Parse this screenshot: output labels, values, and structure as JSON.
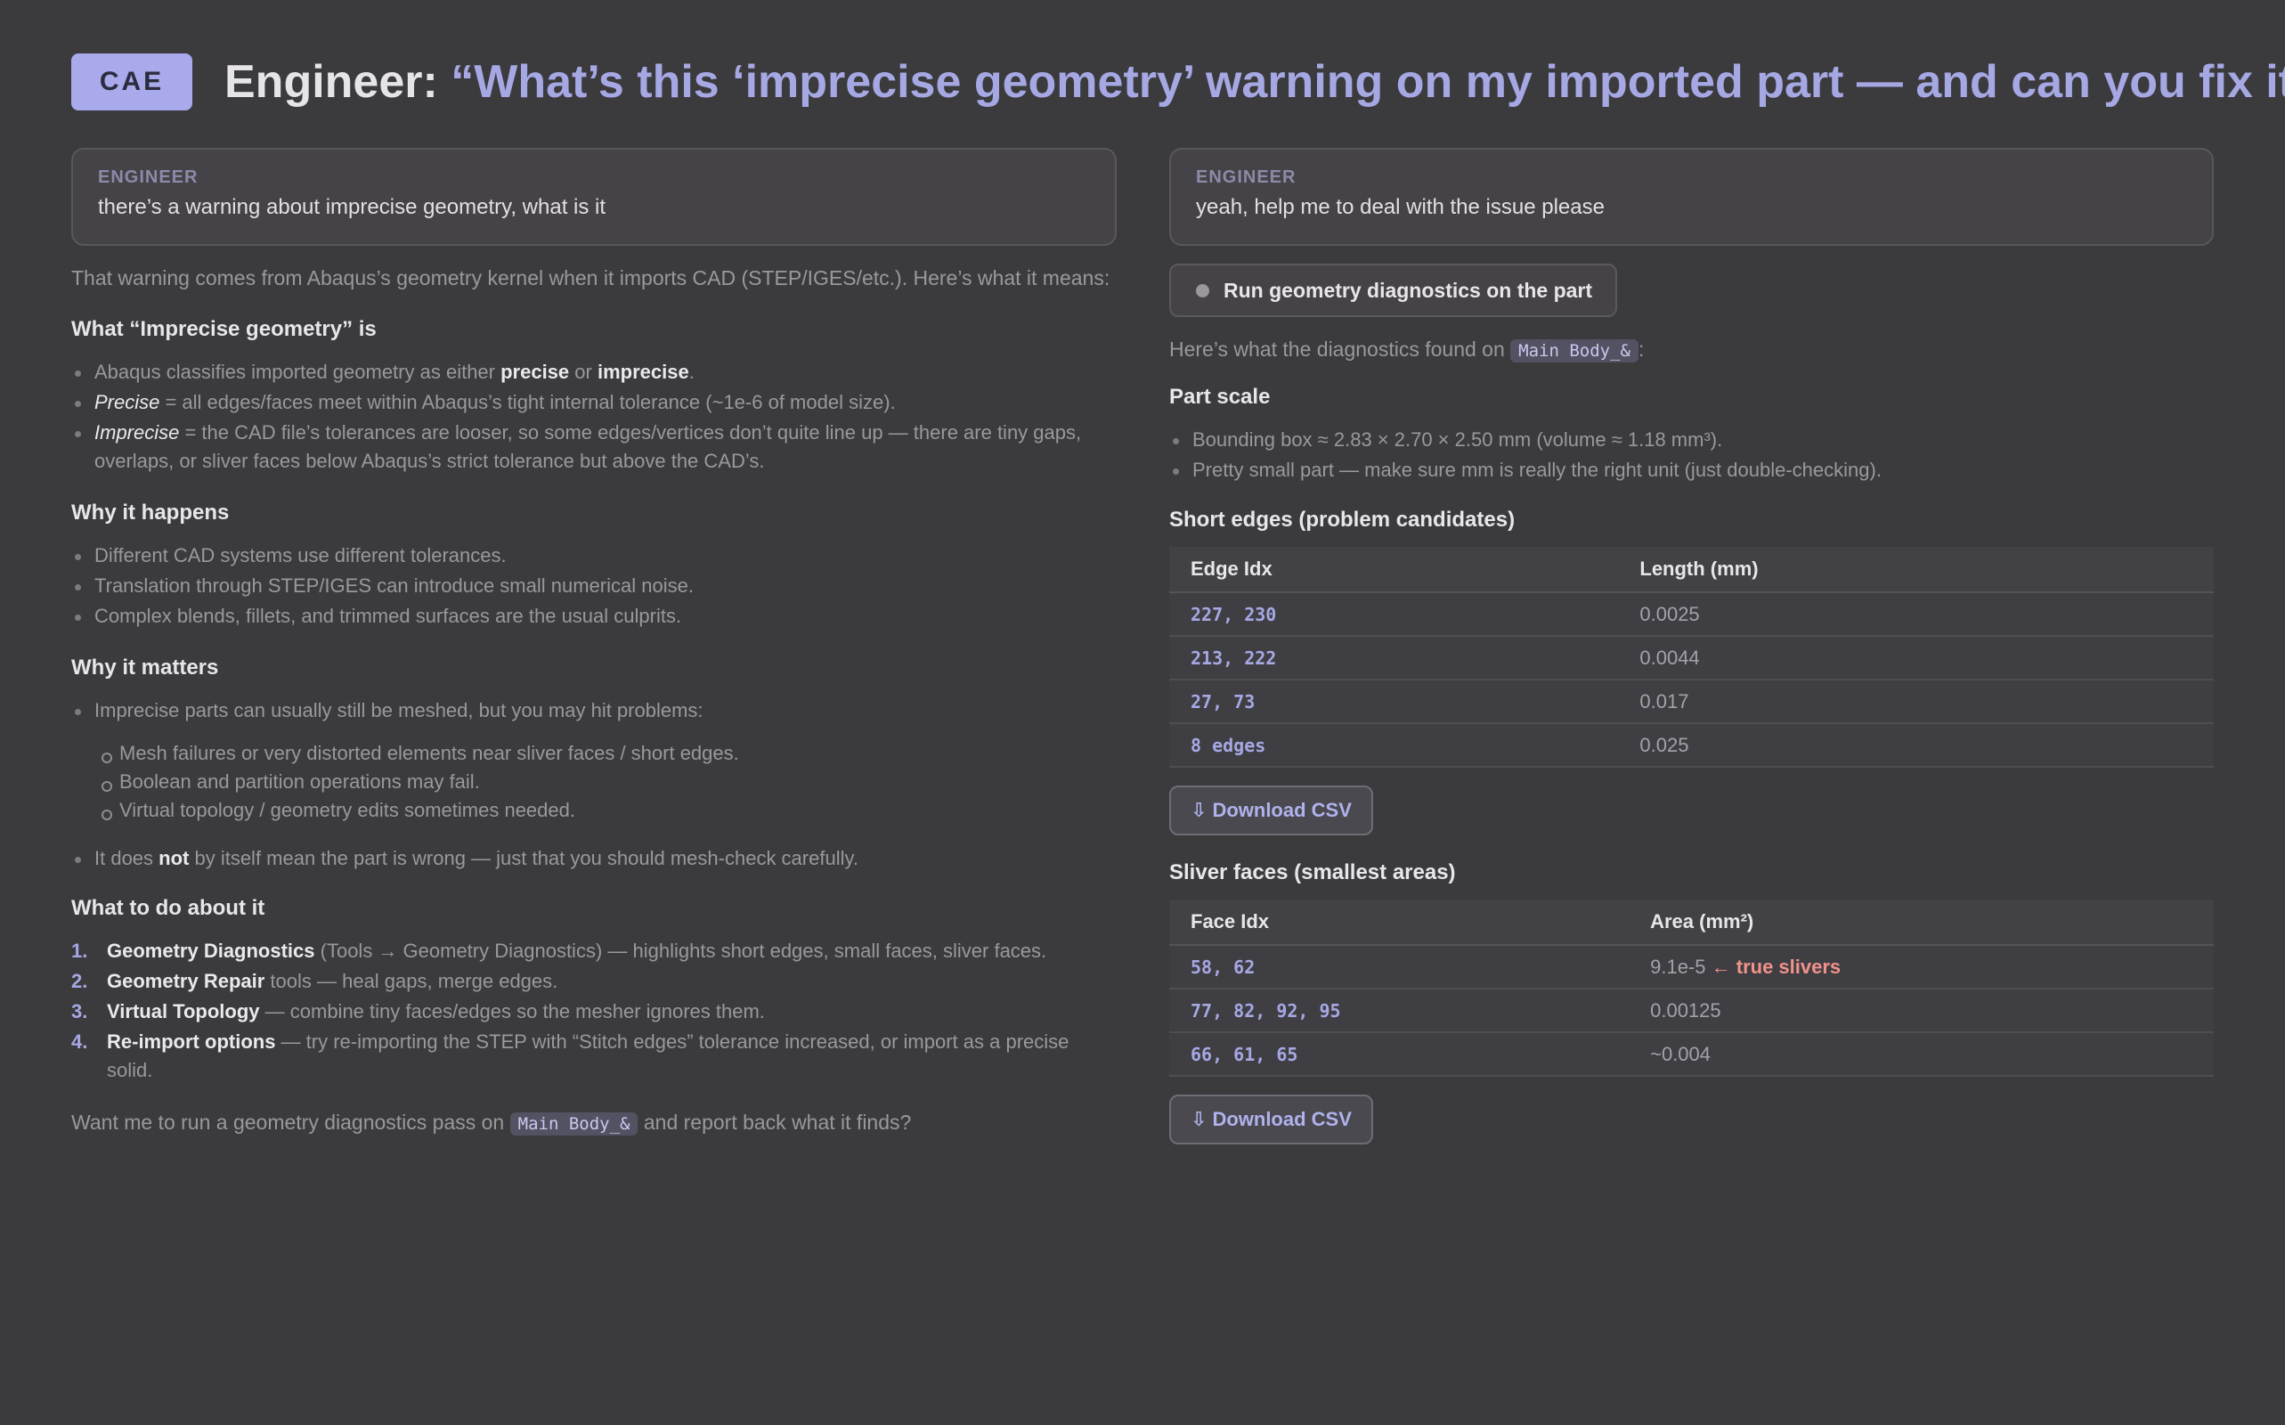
{
  "header": {
    "badge": "CAE",
    "speaker": "Engineer:",
    "question": "“What’s this ‘imprecise geometry’ warning on my imported part — and can you fix it?”"
  },
  "left": {
    "bubble": {
      "role": "ENGINEER",
      "message": "there’s a warning about imprecise geometry, what is it"
    },
    "intro": "That warning comes from Abaqus’s geometry kernel when it imports CAD (STEP/IGES/etc.). Here’s what it means:",
    "what": {
      "heading": "What “Imprecise geometry” is",
      "b1_pre": "Abaqus classifies imported geometry as either ",
      "b1_precise": "precise",
      "b1_or": " or ",
      "b1_imprecise": "imprecise",
      "b1_end": ".",
      "b2_term": "Precise",
      "b2_text": " = all edges/faces meet within Abaqus’s tight internal tolerance (~1e-6 of model size).",
      "b3_term": "Imprecise",
      "b3_text": " = the CAD file’s tolerances are looser, so some edges/vertices don’t quite line up — there are tiny gaps, overlaps, or sliver faces below Abaqus’s strict tolerance but above the CAD’s."
    },
    "why": {
      "heading": "Why it happens",
      "items": [
        "Different CAD systems use different tolerances.",
        "Translation through STEP/IGES can introduce small numerical noise.",
        "Complex blends, fillets, and trimmed surfaces are the usual culprits."
      ]
    },
    "matters": {
      "heading": "Why it matters",
      "lead": "Imprecise parts can usually still be meshed, but you may hit problems:",
      "sub": [
        "Mesh failures or very distorted elements near sliver faces / short edges.",
        "Boolean and partition operations may fail.",
        "Virtual topology / geometry edits sometimes needed."
      ],
      "last_pre": "It does ",
      "last_bold": "not",
      "last_post": " by itself mean the part is wrong — just that you should mesh-check carefully."
    },
    "todo": {
      "heading": "What to do about it",
      "steps": [
        {
          "num": "1.",
          "bold": "Geometry Diagnostics",
          "text": " (Tools → Geometry Diagnostics) — highlights short edges, small faces, sliver faces."
        },
        {
          "num": "2.",
          "bold": "Geometry Repair",
          "text": " tools — heal gaps, merge edges."
        },
        {
          "num": "3.",
          "bold": "Virtual Topology",
          "text": " — combine tiny faces/edges so the mesher ignores them."
        },
        {
          "num": "4.",
          "bold": "Re-import options",
          "text": " — try re-importing the STEP with “Stitch edges” tolerance increased, or import as a precise solid."
        }
      ]
    },
    "closing_pre": "Want me to run a geometry diagnostics pass on ",
    "closing_code": "Main Body_&",
    "closing_post": " and report back what it finds?"
  },
  "right": {
    "bubble": {
      "role": "ENGINEER",
      "message": "yeah, help me to deal with the issue please"
    },
    "tool_label": "Run geometry diagnostics on the part",
    "found_pre": "Here’s what the diagnostics found on ",
    "found_code": "Main Body_&",
    "found_post": ":",
    "scale": {
      "heading": "Part scale",
      "items": [
        "Bounding box ≈ 2.83 × 2.70 × 2.50 mm (volume ≈ 1.18 mm³).",
        "Pretty small part — make sure mm is really the right unit (just double-checking)."
      ]
    },
    "edges": {
      "heading": "Short edges (problem candidates)",
      "col1": "Edge Idx",
      "col2": "Length (mm)",
      "rows": [
        {
          "idx": "227, 230",
          "val": "0.0025"
        },
        {
          "idx": "213, 222",
          "val": "0.0044"
        },
        {
          "idx": "27, 73",
          "val": "0.017"
        },
        {
          "idx": "8 edges",
          "val": "0.025"
        }
      ],
      "download": "Download CSV"
    },
    "faces": {
      "heading": "Sliver faces (smallest areas)",
      "col1": "Face Idx",
      "col2": "Area (mm²)",
      "rows": [
        {
          "idx": "58, 62",
          "val": "9.1e-5",
          "note": "← true slivers"
        },
        {
          "idx": "77, 82, 92, 95",
          "val": "0.00125",
          "note": ""
        },
        {
          "idx": "66, 61, 65",
          "val": "~0.004",
          "note": ""
        }
      ],
      "download": "Download CSV"
    }
  }
}
